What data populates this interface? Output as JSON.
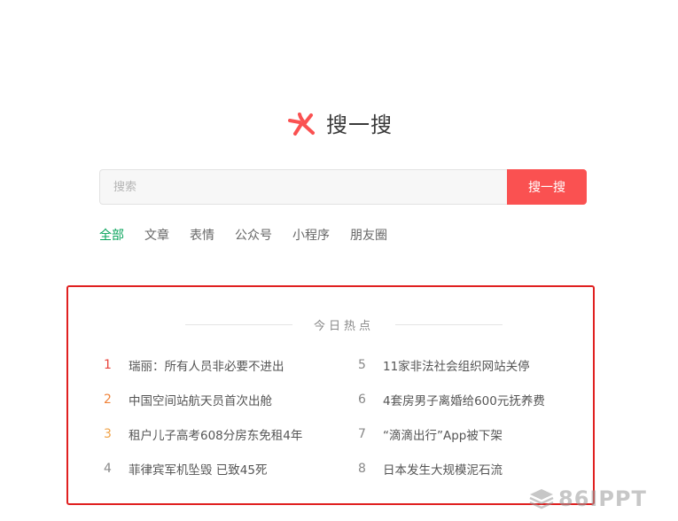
{
  "logo": {
    "icon": "sou-yi-sou-logo-icon",
    "text": "搜一搜"
  },
  "search": {
    "placeholder": "搜索",
    "value": "",
    "button_label": "搜一搜"
  },
  "tabs": [
    {
      "label": "全部",
      "active": true
    },
    {
      "label": "文章",
      "active": false
    },
    {
      "label": "表情",
      "active": false
    },
    {
      "label": "公众号",
      "active": false
    },
    {
      "label": "小程序",
      "active": false
    },
    {
      "label": "朋友圈",
      "active": false
    }
  ],
  "hot": {
    "title": "今日热点",
    "items": [
      {
        "rank": "1",
        "text": "瑞丽：所有人员非必要不进出",
        "rank_color": "#e8433b"
      },
      {
        "rank": "2",
        "text": "中国空间站航天员首次出舱",
        "rank_color": "#f0833a"
      },
      {
        "rank": "3",
        "text": "租户儿子高考608分房东免租4年",
        "rank_color": "#f0a348"
      },
      {
        "rank": "4",
        "text": "菲律宾军机坠毁 已致45死",
        "rank_color": "#888888"
      },
      {
        "rank": "5",
        "text": "11家非法社会组织网站关停",
        "rank_color": "#888888"
      },
      {
        "rank": "6",
        "text": "4套房男子离婚给600元抚养费",
        "rank_color": "#888888"
      },
      {
        "rank": "7",
        "text": "“滴滴出行”App被下架",
        "rank_color": "#888888"
      },
      {
        "rank": "8",
        "text": "日本发生大规模泥石流",
        "rank_color": "#888888"
      }
    ]
  },
  "watermark": {
    "text": "86IPPT"
  },
  "colors": {
    "accent_red": "#fa5151",
    "active_tab": "#07a35a",
    "highlight_border": "#e02020"
  }
}
